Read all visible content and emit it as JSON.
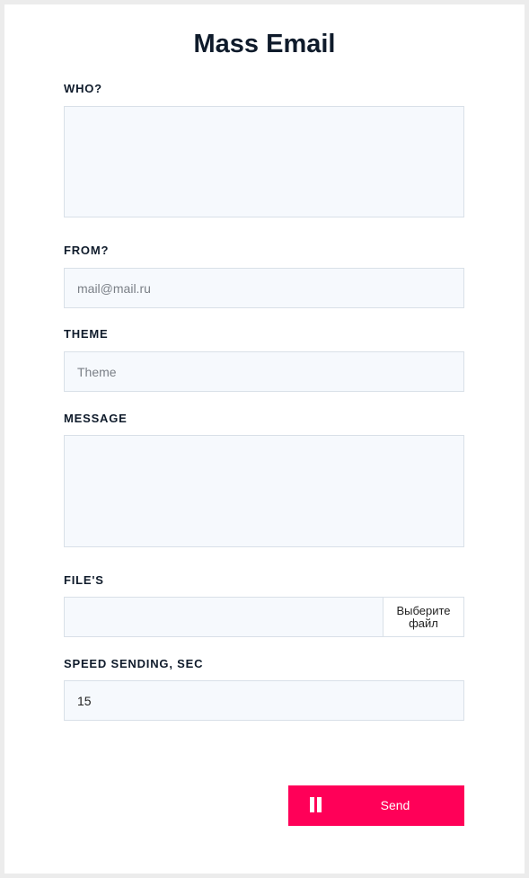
{
  "form": {
    "title": "Mass Email",
    "who": {
      "label": "WHO?",
      "value": "",
      "placeholder": ""
    },
    "from": {
      "label": "FROM?",
      "value": "",
      "placeholder": "mail@mail.ru"
    },
    "theme": {
      "label": "THEME",
      "value": "",
      "placeholder": "Theme"
    },
    "message": {
      "label": "MESSAGE",
      "value": "",
      "placeholder": ""
    },
    "files": {
      "label": "FILE'S",
      "button_label": "Выберите файл"
    },
    "speed": {
      "label": "SPEED SENDING, SEC",
      "value": "15"
    },
    "send": {
      "label": "Send",
      "icon": "pause-icon"
    }
  },
  "colors": {
    "accent": "#ff0058",
    "field_bg": "#f6f9fd",
    "field_border": "#d9e0e8",
    "text": "#0f1b2b",
    "page_bg": "#ececec"
  }
}
